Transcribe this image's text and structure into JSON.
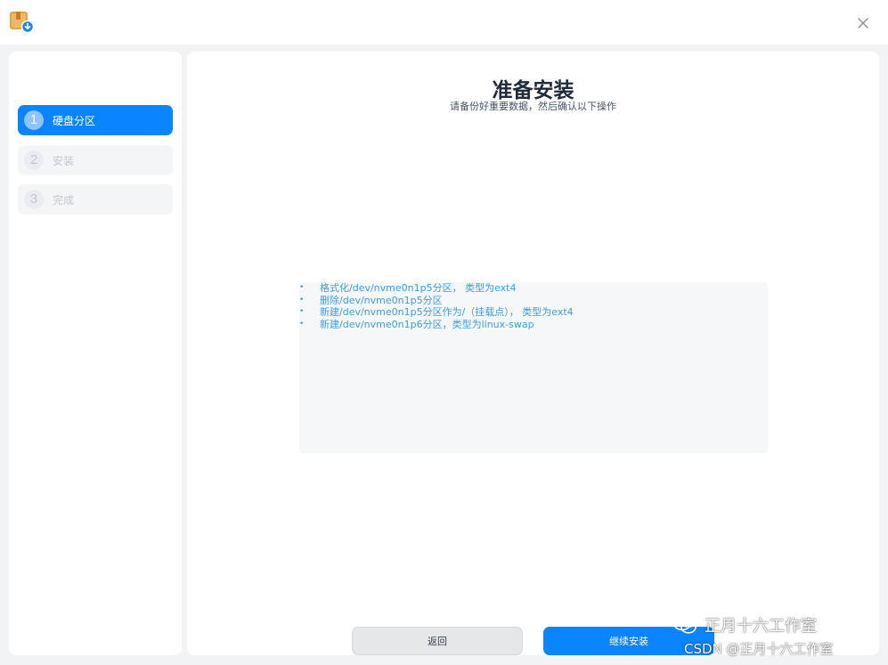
{
  "sidebar": {
    "steps": [
      {
        "num": "1",
        "label": "硬盘分区",
        "active": true
      },
      {
        "num": "2",
        "label": "安装",
        "active": false
      },
      {
        "num": "3",
        "label": "完成",
        "active": false
      }
    ]
  },
  "main": {
    "title": "准备安装",
    "subtitle": "请备份好重要数据，然后确认以下操作",
    "bullet": "•",
    "operations": [
      "格式化/dev/nvme0n1p5分区，  类型为ext4",
      "删除/dev/nvme0n1p5分区",
      "新建/dev/nvme0n1p5分区作为/（挂载点），  类型为ext4",
      "新建/dev/nvme0n1p6分区，类型为linux-swap"
    ]
  },
  "buttons": {
    "back_label": "返回",
    "continue_label": "继续安装"
  },
  "watermark": {
    "line1": "正月十六工作室",
    "line2": "CSDN @正月十六工作室"
  },
  "icons": {
    "app": "installer-package-icon",
    "close": "close-icon",
    "wechat": "wechat-icon"
  },
  "colors": {
    "accent": "#0a84ff",
    "operation_text": "#3b9de8",
    "title": "#1f2a3d"
  }
}
